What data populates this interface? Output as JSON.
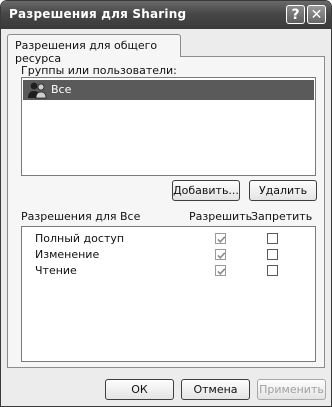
{
  "window": {
    "title": "Разрешения для Sharing"
  },
  "titlebar_buttons": {
    "help": "?",
    "close": "✕"
  },
  "tab": {
    "label": "Разрешения для общего ресурса"
  },
  "groups": {
    "label": "Группы или пользователи:",
    "items": [
      {
        "name": "Все",
        "selected": true
      }
    ]
  },
  "buttons": {
    "add": "Добавить...",
    "remove": "Удалить",
    "ok": "ОК",
    "cancel": "Отмена",
    "apply": "Применить"
  },
  "permissions": {
    "header_label": "Разрешения для Все",
    "allow_label": "Разрешить",
    "deny_label": "Запретить",
    "rows": [
      {
        "name": "Полный доступ",
        "allow": true,
        "deny": false
      },
      {
        "name": "Изменение",
        "allow": true,
        "deny": false
      },
      {
        "name": "Чтение",
        "allow": true,
        "deny": false
      }
    ]
  }
}
